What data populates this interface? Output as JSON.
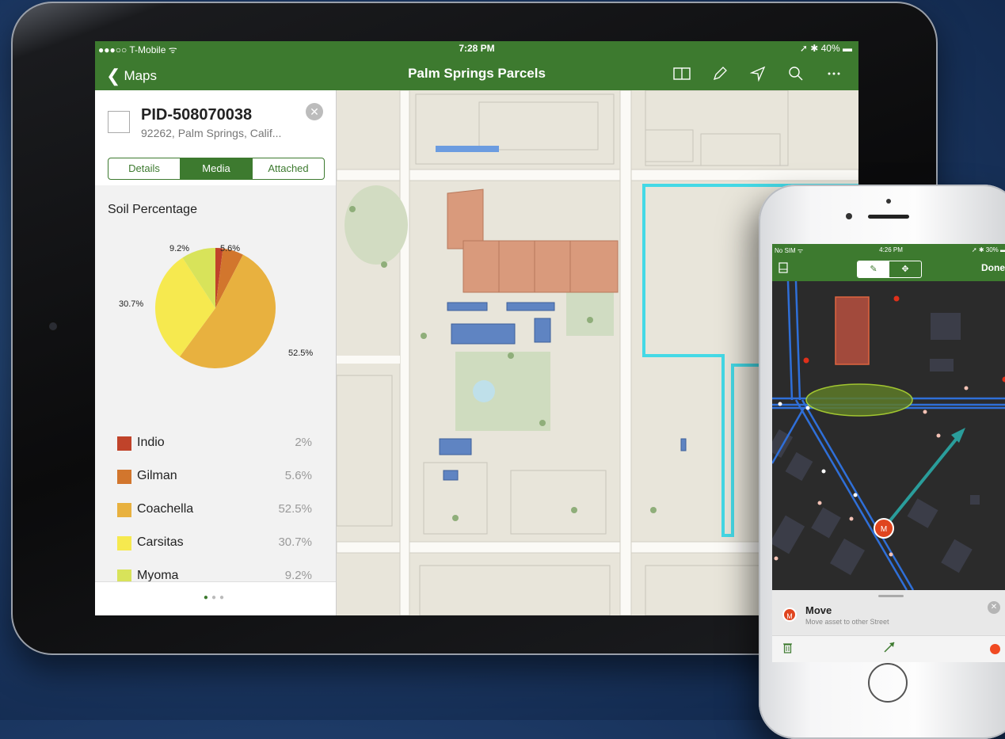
{
  "ipad": {
    "status": {
      "carrier": "●●●○○ T-Mobile ᯤ",
      "time": "7:28 PM",
      "battery": "➚ ✱ 40% ▬"
    },
    "nav": {
      "back": "Maps",
      "title": "Palm Springs Parcels"
    },
    "tools": [
      "split-view-icon",
      "pencil-icon",
      "location-arrow-icon",
      "search-icon",
      "more-icon"
    ],
    "feature": {
      "id": "PID-508070038",
      "address": "92262, Palm Springs, Calif...",
      "close": "✕"
    },
    "tabs": [
      {
        "label": "Details"
      },
      {
        "label": "Media",
        "active": true
      },
      {
        "label": "Attached"
      }
    ],
    "chart_title": "Soil Percentage",
    "legend": [
      {
        "name": "Indio",
        "value": "2%"
      },
      {
        "name": "Gilman",
        "value": "5.6%"
      },
      {
        "name": "Coachella",
        "value": "52.5%"
      },
      {
        "name": "Carsitas",
        "value": "30.7%"
      },
      {
        "name": "Myoma",
        "value": "9.2%"
      }
    ],
    "page_dots": "● ● ●"
  },
  "chart_data": {
    "type": "pie",
    "title": "Soil Percentage",
    "categories": [
      "Indio",
      "Gilman",
      "Coachella",
      "Carsitas",
      "Myoma"
    ],
    "values": [
      2,
      5.6,
      52.5,
      30.7,
      9.2
    ],
    "labels": [
      "",
      "5.6%",
      "52.5%",
      "30.7%",
      "9.2%"
    ],
    "colors": [
      "#c0432a",
      "#d2762d",
      "#e8b13f",
      "#f6e94f",
      "#d8e35a"
    ]
  },
  "iphone": {
    "status": {
      "carrier": "No SIM ᯤ",
      "time": "4:26 PM",
      "battery": "➚ ✱ 30% ▬"
    },
    "nav": {
      "done": "Done",
      "seg_edit": "✎",
      "seg_move": "✥"
    },
    "card": {
      "badge": "M",
      "title": "Move",
      "subtitle": "Move asset to other Street",
      "close": "✕"
    },
    "tools": [
      "trash-icon",
      "arrow-icon",
      "record-icon"
    ]
  },
  "colors": {
    "brand_green": "#3d7a2f",
    "highlight_cyan": "#27d7e8",
    "marker_red": "#e0451f"
  }
}
